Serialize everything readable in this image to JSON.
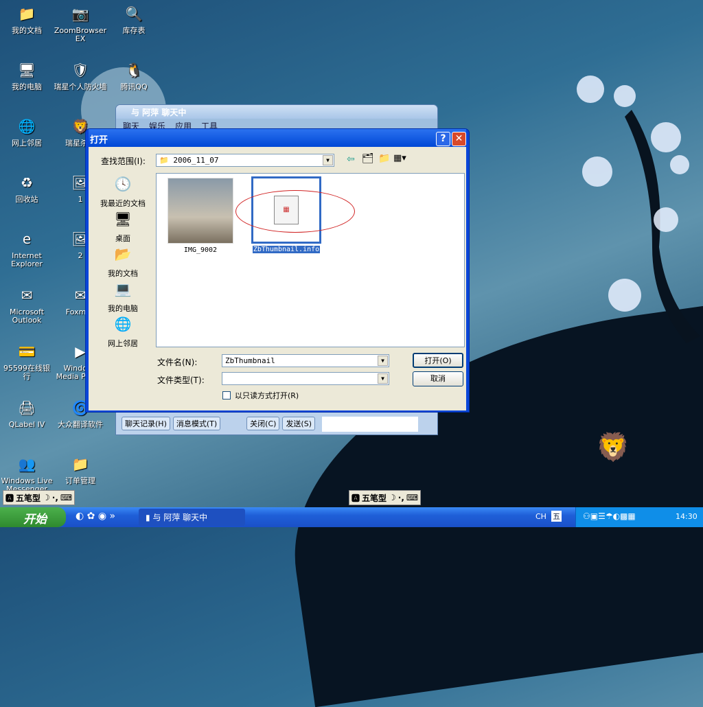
{
  "desktop": {
    "icons": [
      {
        "label": "我的文档",
        "glyph": "📁"
      },
      {
        "label": "ZoomBrowser EX",
        "glyph": "📷"
      },
      {
        "label": "库存表",
        "glyph": "🔍"
      },
      {
        "label": "我的电脑",
        "glyph": "🖥"
      },
      {
        "label": "瑞星个人防火墙",
        "glyph": "🛡"
      },
      {
        "label": "腾讯QQ",
        "glyph": "🐧"
      },
      {
        "label": "网上邻居",
        "glyph": "🌐"
      },
      {
        "label": "瑞星杀毒",
        "glyph": "🦁"
      },
      {
        "label": "回收站",
        "glyph": "♻"
      },
      {
        "label": "1",
        "glyph": "🖼"
      },
      {
        "label": "Internet Explorer",
        "glyph": "e"
      },
      {
        "label": "2",
        "glyph": "🖼"
      },
      {
        "label": "Microsoft Outlook",
        "glyph": "✉"
      },
      {
        "label": "Foxmail",
        "glyph": "✉"
      },
      {
        "label": "95599在线银行",
        "glyph": "💳"
      },
      {
        "label": "Windows Media Player",
        "glyph": "▶"
      },
      {
        "label": "QLabel IV",
        "glyph": "🖨"
      },
      {
        "label": "大众翻译软件",
        "glyph": "🌀"
      },
      {
        "label": "Windows Live Messenger",
        "glyph": "👥"
      },
      {
        "label": "订单管理",
        "glyph": "📁"
      }
    ]
  },
  "chat": {
    "title": "与 阿萍 聊天中",
    "tabs": [
      "聊天",
      "娱乐",
      "应用",
      "工具"
    ],
    "buttons": [
      "聊天记录(H)",
      "消息模式(T)",
      "关闭(C)",
      "发送(S)"
    ]
  },
  "dialog": {
    "title": "打开",
    "look_in_label": "查找范围(I):",
    "look_in_value": "2006_11_07",
    "places": [
      "我最近的文档",
      "桌面",
      "我的文档",
      "我的电脑",
      "网上邻居"
    ],
    "files": [
      {
        "name": "IMG_9002",
        "selected": false
      },
      {
        "name": "ZbThumbnail.info",
        "selected": true
      }
    ],
    "filename_label": "文件名(N):",
    "filename_value": "ZbThumbnail",
    "filetype_label": "文件类型(T):",
    "filetype_value": "",
    "readonly_label": "以只读方式打开(R)",
    "readonly_checked": false,
    "open_button": "打开(O)",
    "cancel_button": "取消"
  },
  "ime": {
    "label": "五笔型"
  },
  "taskbar": {
    "start": "开始",
    "task": "与 阿萍 聊天中",
    "lang": "CH",
    "ime_indicator": "五",
    "clock": "14:30"
  }
}
